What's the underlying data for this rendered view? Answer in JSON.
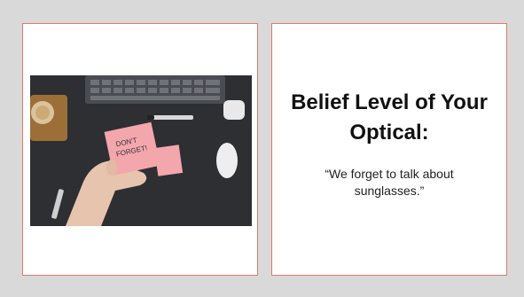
{
  "slide": {
    "title": "Belief Level of Your Optical:",
    "quote": "“We forget to talk about sunglasses.”",
    "photo_note_text": [
      "DON'T",
      "FORGET!"
    ]
  },
  "colors": {
    "background": "#d9d9d9",
    "panel_border": "#e07b6a",
    "sticky_note": "#f4a6ad",
    "desk": "#2c2d30"
  }
}
